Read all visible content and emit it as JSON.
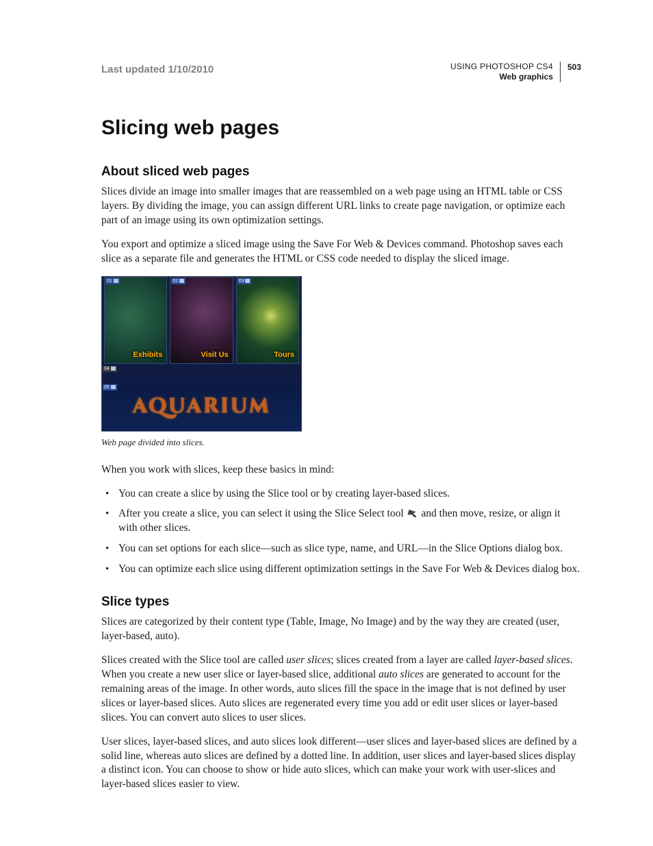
{
  "header": {
    "last_updated": "Last updated 1/10/2010",
    "doc_title": "USING PHOTOSHOP CS4",
    "section_label": "Web graphics",
    "page_number": "503"
  },
  "page_title": "Slicing web pages",
  "section_about": {
    "heading": "About sliced web pages",
    "p1": "Slices divide an image into smaller images that are reassembled on a web page using an HTML table or CSS layers. By dividing the image, you can assign different URL links to create page navigation, or optimize each part of an image using its own optimization settings.",
    "p2": "You export and optimize a sliced image using the Save For Web & Devices command. Photoshop saves each slice as a separate file and generates the HTML or CSS code needed to display the sliced image.",
    "figure": {
      "caption": "Web page divided into slices.",
      "slice_tags": {
        "s01": "01",
        "s02": "02",
        "s03": "03",
        "s04": "04",
        "s05": "05"
      },
      "labels": {
        "exhibits": "Exhibits",
        "visit": "Visit Us",
        "tours": "Tours"
      },
      "logo_text": "AQUARIUM"
    },
    "p3": "When you work with slices, keep these basics in mind:",
    "bullets": {
      "b1": "You can create a slice by using the Slice tool or by creating layer-based slices.",
      "b2a": "After you create a slice, you can select it using the Slice Select tool ",
      "b2b": " and then move, resize, or align it with other slices.",
      "b3": "You can set options for each slice—such as slice type, name, and URL—in the Slice Options dialog box.",
      "b4": "You can optimize each slice using different optimization settings in the Save For Web & Devices dialog box."
    }
  },
  "section_types": {
    "heading": "Slice types",
    "p1": "Slices are categorized by their content type (Table, Image, No Image) and by the way they are created (user, layer-based, auto).",
    "p2_a": "Slices created with the Slice tool are called ",
    "p2_em1": "user slices",
    "p2_b": "; slices created from a layer are called ",
    "p2_em2": "layer-based slices",
    "p2_c": ". When you create a new user slice or layer-based slice, additional ",
    "p2_em3": "auto slices",
    "p2_d": " are generated to account for the remaining areas of the image. In other words, auto slices fill the space in the image that is not defined by user slices or layer-based slices. Auto slices are regenerated every time you add or edit user slices or layer-based slices. You can convert auto slices to user slices.",
    "p3": "User slices, layer-based slices, and auto slices look different—user slices and layer-based slices are defined by a solid line, whereas auto slices are defined by a dotted line. In addition, user slices and layer-based slices display a distinct icon. You can choose to show or hide auto slices, which can make your work with user-slices and layer-based slices easier to view."
  }
}
